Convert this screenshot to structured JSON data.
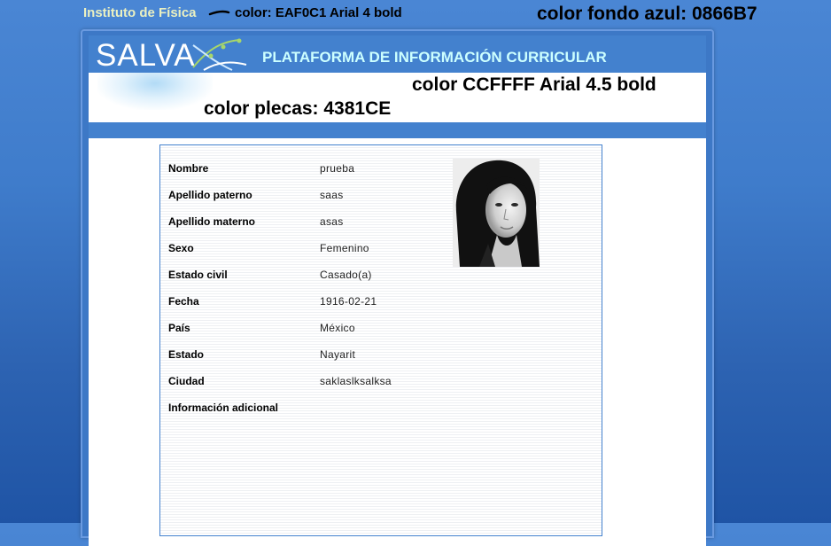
{
  "top_title": "Instituto de Física",
  "annotations": {
    "title_color_note": "color: EAF0C1  Arial 4 bold",
    "bg_color_note": "color fondo azul: 0866B7",
    "header_color_note": "color CCFFFF Arial 4.5 bold",
    "pleca_color_note": "color plecas: 4381CE"
  },
  "header": {
    "logo": "SALVA",
    "title": "PLATAFORMA DE INFORMACIÓN CURRICULAR"
  },
  "colors": {
    "background_blue": "#0866B7",
    "pleca": "#4381CE",
    "header_text": "#CCFFFF",
    "top_title": "#EAF0C1"
  },
  "profile": {
    "fields": [
      {
        "label": "Nombre",
        "value": "prueba"
      },
      {
        "label": "Apellido paterno",
        "value": "saas"
      },
      {
        "label": "Apellido materno",
        "value": "asas"
      },
      {
        "label": "Sexo",
        "value": "Femenino"
      },
      {
        "label": "Estado civil",
        "value": "Casado(a)"
      },
      {
        "label": "Fecha",
        "value": "1916-02-21"
      },
      {
        "label": "País",
        "value": "México"
      },
      {
        "label": "Estado",
        "value": "Nayarit"
      },
      {
        "label": "Ciudad",
        "value": "saklaslksalksa"
      },
      {
        "label": "Información adicional",
        "value": ""
      }
    ]
  }
}
